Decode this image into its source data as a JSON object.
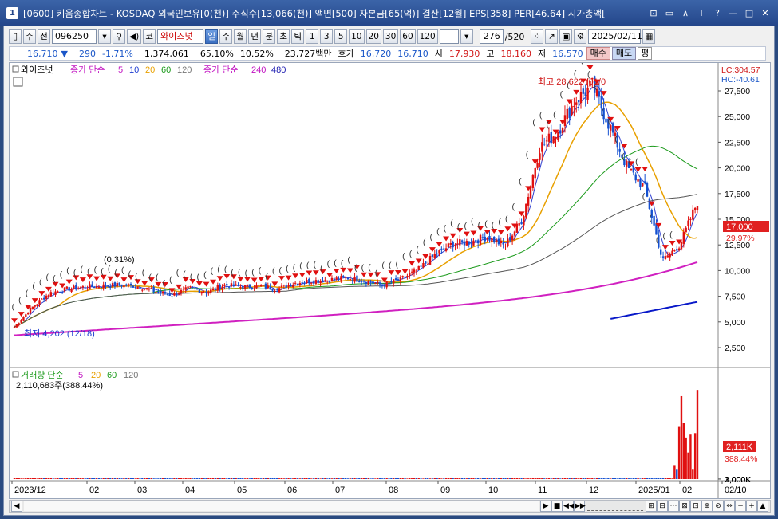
{
  "window": {
    "app_number": "1",
    "title": "[0600] 키움종합차트 - KOSDAQ 외국인보유[0(천)] 주식수[13,066(천)] 액면[500] 자본금[65(억)] 결산[12월] EPS[358] PER[46.64] 시가총액[",
    "buttons": [
      "⊡",
      "▭",
      "⊼",
      "T",
      "?",
      "—",
      "□",
      "✕"
    ]
  },
  "toolbar": {
    "period_label": "주",
    "prev_label": "전",
    "code_value": "096250",
    "market_label": "코",
    "name_value": "와이즈넛",
    "period_buttons": [
      "일",
      "주",
      "월",
      "년",
      "분",
      "초",
      "틱"
    ],
    "active_period": "일",
    "minute_buttons": [
      "1",
      "3",
      "5",
      "10",
      "20",
      "30",
      "60",
      "120"
    ],
    "count_value": "276",
    "count_total": "/520",
    "date_value": "2025/02/11"
  },
  "quote": {
    "price": "16,710",
    "change_arrow": "▼",
    "change": "290",
    "change_pct": "-1.71%",
    "volume": "1,374,061",
    "ratio1": "65.10%",
    "ratio2": "10.52%",
    "amount": "23,727백만",
    "ask_label": "호가",
    "ask": "16,720",
    "bid": "16,710",
    "open_label": "시",
    "open": "17,930",
    "high_label": "고",
    "high": "18,160",
    "low_label": "저",
    "low": "16,570",
    "buy_button": "매수",
    "sell_button": "매도",
    "avg_button": "평"
  },
  "price_panel": {
    "legend_name": "와이즈넛",
    "legend_ma_label": "종가 단순",
    "ma_short": [
      "5",
      "10",
      "20",
      "60",
      "120"
    ],
    "legend_ma_label2": "종가 단순",
    "ma_long": [
      "240",
      "480"
    ],
    "lc_label": "LC:304.57",
    "hc_label": "HC:-40.61",
    "high_annotation": "최고 28,622 (01/0",
    "low_annotation": "최저 4,202 (12/18)",
    "first_pct_label": "(0.31%)",
    "current_price_tag": "17,000",
    "current_pct_tag": "29.97%",
    "y_ticks": [
      "27,500",
      "25,000",
      "22,500",
      "20,000",
      "17,500",
      "15,000",
      "12,500",
      "10,000",
      "7,500",
      "5,000",
      "2,500"
    ]
  },
  "volume_panel": {
    "legend_label": "거래량 단순",
    "ma": [
      "5",
      "20",
      "60",
      "120"
    ],
    "last_value": "2,110,683주(388.44%)",
    "y_ticks": [
      "3,000K",
      "2,000K",
      "1,000K"
    ],
    "current_tag": "2,111K",
    "current_pct": "388.44%"
  },
  "x_axis": {
    "labels": [
      "2023/12",
      "02",
      "03",
      "04",
      "05",
      "06",
      "07",
      "08",
      "09",
      "10",
      "11",
      "12",
      "2025/01",
      "02",
      "02/10"
    ]
  },
  "chart_data": {
    "type": "line",
    "title": "",
    "series": [
      {
        "name": "",
        "values": [
          4.5,
          6.4,
          7.8,
          8.2,
          8.4,
          8.5,
          8.6,
          8.5,
          8.0,
          7.6,
          8.3,
          7.9,
          8.6,
          8.4,
          8.5,
          8.2,
          8.8,
          9.0,
          9.1,
          9.3,
          9.0,
          8.6,
          9.1,
          10.0,
          11.5,
          12.6,
          12.8,
          13.3,
          12.4,
          15.0,
          22.0,
          23.5,
          26.5,
          28.0,
          24.0,
          20.0,
          18.0,
          11.0,
          12.5,
          16.7
        ]
      }
    ],
    "ylabel": "",
    "ylim": [
      2.5,
      28.6
    ],
    "colors": {
      "up": "#e01010",
      "down": "#1450d0",
      "ma5": "#e8a000",
      "ma20": "#1a9a1a",
      "ma120": "#555555",
      "ma240": "#d020c0",
      "ma480": "#0818c8"
    }
  }
}
